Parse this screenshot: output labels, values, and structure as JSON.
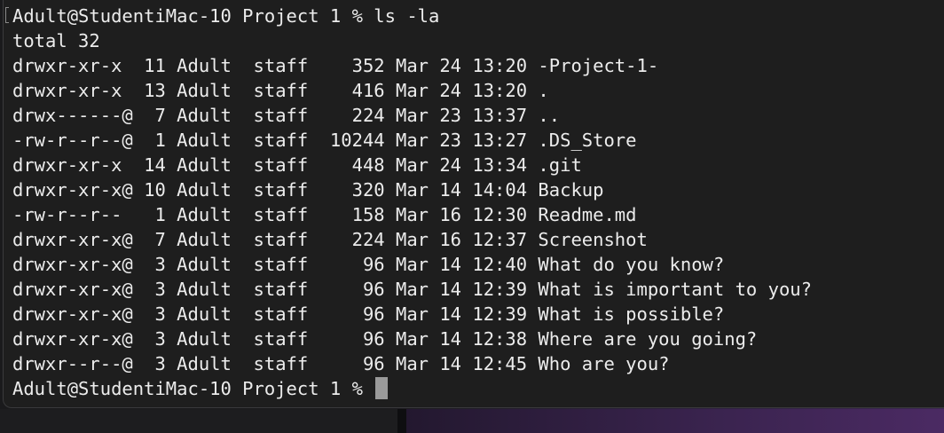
{
  "terminal": {
    "prompt_line": "Adult@StudentiMac-10 Project 1 % ls -la",
    "total_line": "total 32",
    "entries": [
      "drwxr-xr-x  11 Adult  staff    352 Mar 24 13:20 -Project-1-",
      "drwxr-xr-x  13 Adult  staff    416 Mar 24 13:20 .",
      "drwx------@  7 Adult  staff    224 Mar 23 13:37 ..",
      "-rw-r--r--@  1 Adult  staff  10244 Mar 23 13:27 .DS_Store",
      "drwxr-xr-x  14 Adult  staff    448 Mar 24 13:34 .git",
      "drwxr-xr-x@ 10 Adult  staff    320 Mar 14 14:04 Backup",
      "-rw-r--r--   1 Adult  staff    158 Mar 16 12:30 Readme.md",
      "drwxr-xr-x@  7 Adult  staff    224 Mar 16 12:37 Screenshot",
      "drwxr-xr-x@  3 Adult  staff     96 Mar 14 12:40 What do you know?",
      "drwxr-xr-x@  3 Adult  staff     96 Mar 14 12:39 What is important to you?",
      "drwxr-xr-x@  3 Adult  staff     96 Mar 14 12:39 What is possible?",
      "drwxr-xr-x@  3 Adult  staff     96 Mar 14 12:38 Where are you going?",
      "drwxr--r--@  3 Adult  staff     96 Mar 14 12:45 Who are you?"
    ],
    "current_prompt": "Adult@StudentiMac-10 Project 1 % "
  },
  "colors": {
    "background": "#1e1e1e",
    "text": "#ececec",
    "cursor": "#9a9a9a"
  }
}
